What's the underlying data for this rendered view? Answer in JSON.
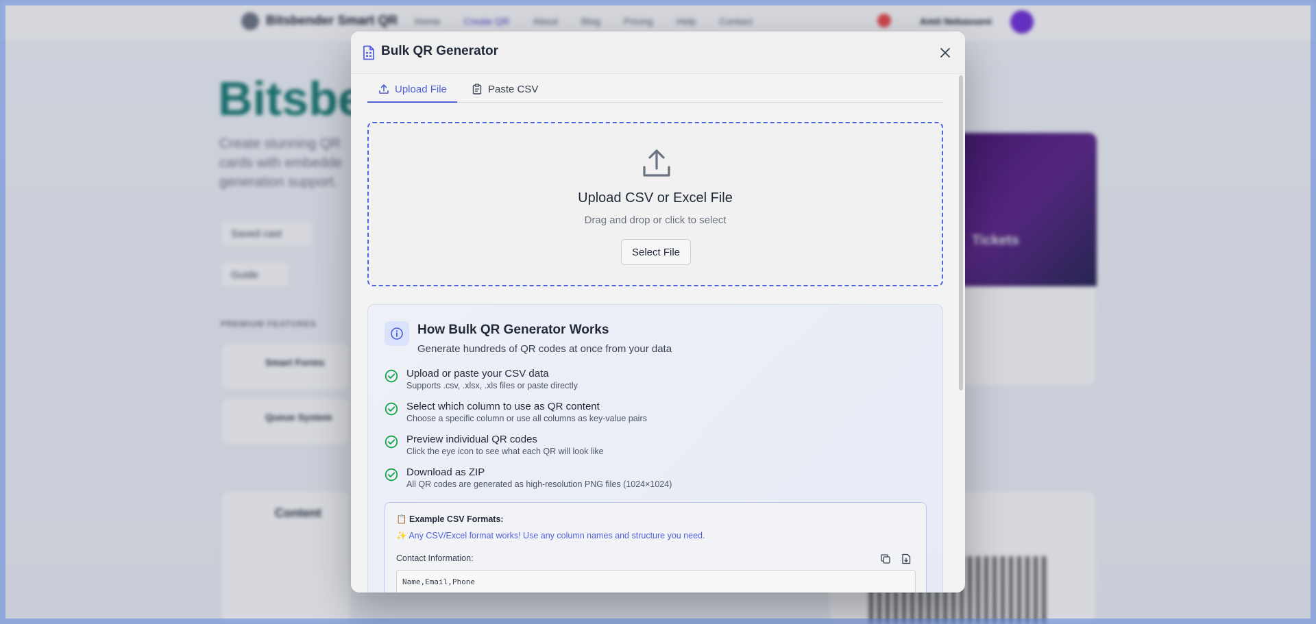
{
  "background": {
    "brand": "Bitsbender Smart QR",
    "nav_links": [
      "Home",
      "Create QR",
      "About",
      "Blog",
      "Pricing",
      "Help",
      "Contact"
    ],
    "active_nav": "Create QR",
    "user_name": "Amit Nebasseni",
    "hero_title": "Bitsber",
    "hero_desc": "Create stunning QR cards with embedde generation support.",
    "pills": [
      "Saved cast",
      "Guide"
    ],
    "section_label": "PREMIUM FEATURES",
    "features": [
      "Smart Forms",
      "Queue System"
    ],
    "content_title": "Content",
    "image_caption": "Tickets"
  },
  "modal": {
    "title": "Bulk QR Generator",
    "tabs": [
      {
        "label": "Upload File",
        "active": true
      },
      {
        "label": "Paste CSV",
        "active": false
      }
    ],
    "dropzone": {
      "title": "Upload CSV or Excel File",
      "subtitle": "Drag and drop or click to select",
      "button": "Select File"
    },
    "info": {
      "title": "How Bulk QR Generator Works",
      "subtitle": "Generate hundreds of QR codes at once from your data",
      "steps": [
        {
          "title": "Upload or paste your CSV data",
          "desc": "Supports .csv, .xlsx, .xls files or paste directly"
        },
        {
          "title": "Select which column to use as QR content",
          "desc": "Choose a specific column or use all columns as key-value pairs"
        },
        {
          "title": "Preview individual QR codes",
          "desc": "Click the eye icon to see what each QR will look like"
        },
        {
          "title": "Download as ZIP",
          "desc": "All QR codes are generated as high-resolution PNG files (1024×1024)"
        }
      ],
      "examples": {
        "title": "📋 Example CSV Formats:",
        "note": "✨ Any CSV/Excel format works! Use any column names and structure you need.",
        "label": "Contact Information:",
        "code": "Name,Email,Phone"
      }
    }
  },
  "colors": {
    "accent": "#4f5fd9",
    "check": "#16a34a",
    "brand_teal": "#0f766e"
  }
}
